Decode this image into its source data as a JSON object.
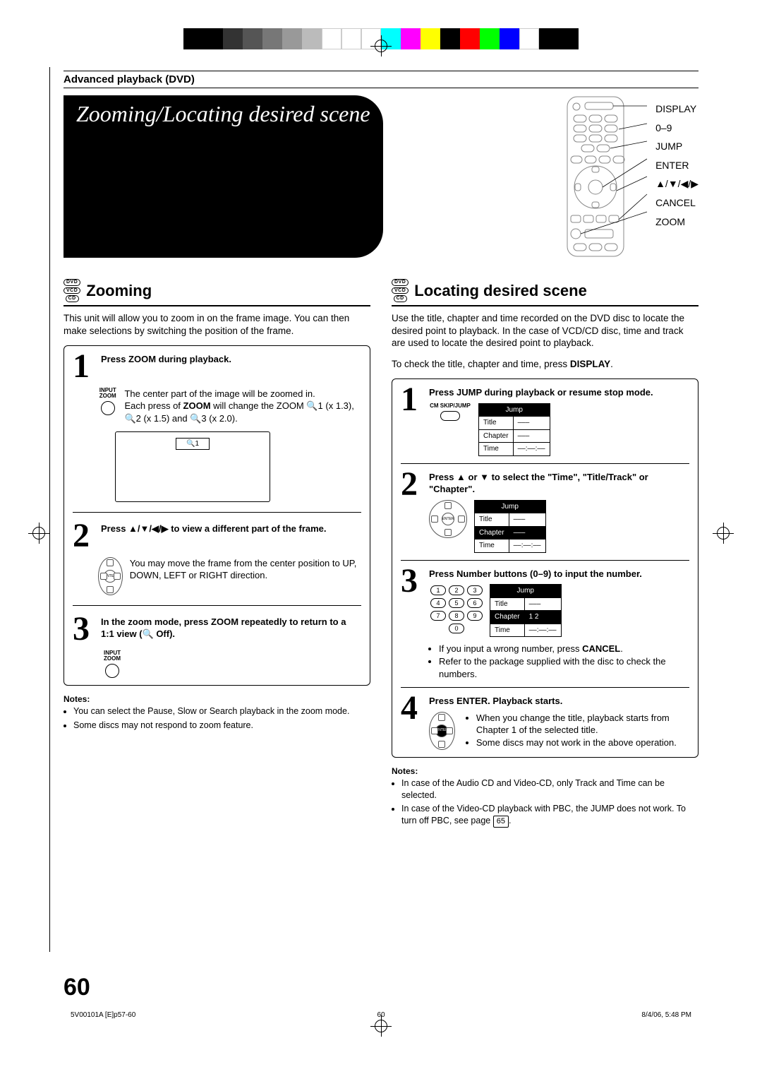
{
  "header": "Advanced playback (DVD)",
  "title": "Zooming/Locating desired scene",
  "remote_labels": [
    "DISPLAY",
    "0–9",
    "JUMP",
    "ENTER",
    "▲/▼/◀/▶",
    "CANCEL",
    "ZOOM"
  ],
  "discs_all": [
    "DVD",
    "VCD",
    "CD"
  ],
  "zoom": {
    "heading": "Zooming",
    "intro": "This unit will allow you to zoom in on the frame image. You can then make selections by switching the position of the frame.",
    "step1": {
      "lead": "Press ZOOM during playback.",
      "icon_label": "INPUT\nZOOM",
      "body_a": "The center part of the image will be zoomed in.",
      "body_b_pre": "Each press of ",
      "body_b_btn": "ZOOM",
      "body_b_post": " will change the ZOOM 🔍1 (x 1.3), 🔍2 (x 1.5) and 🔍3 (x 2.0).",
      "screen_tab": "🔍1"
    },
    "step2": {
      "lead": "Press ▲/▼/◀/▶ to view a different part of the frame.",
      "body": "You may move the frame from the center position to UP, DOWN, LEFT or RIGHT direction."
    },
    "step3": {
      "lead": "In the zoom mode, press ZOOM repeatedly to return to a 1:1 view (🔍 Off).",
      "icon_label": "INPUT\nZOOM"
    },
    "notes_head": "Notes:",
    "notes": [
      "You can select the Pause, Slow or Search playback in the zoom mode.",
      "Some discs may not respond to zoom feature."
    ]
  },
  "locate": {
    "heading": "Locating desired scene",
    "intro": "Use the title, chapter and time recorded on the DVD disc to locate the desired point to playback. In the case of VCD/CD disc, time and track are used to locate the desired point to playback.",
    "check_pre": "To check the title, chapter and time, press ",
    "check_btn": "DISPLAY",
    "check_post": ".",
    "step1": {
      "lead": "Press JUMP during playback or resume stop mode.",
      "icon_label": "CM SKIP/JUMP"
    },
    "step2": {
      "lead": "Press ▲ or ▼ to select the \"Time\", \"Title/Track\" or \"Chapter\"."
    },
    "step3": {
      "lead": "Press Number buttons (0–9) to input the number.",
      "bul1_pre": "If you input a wrong number, press ",
      "bul1_btn": "CANCEL",
      "bul1_post": ".",
      "bul2": "Refer to the package supplied with the disc to check the numbers."
    },
    "step4": {
      "lead": "Press ENTER. Playback starts.",
      "bul1": "When you change the title, playback starts from Chapter 1 of the selected title.",
      "bul2": "Some discs may not work in the above operation."
    },
    "menu": {
      "header": "Jump",
      "rows": [
        "Title",
        "Chapter",
        "Time"
      ],
      "blank3": "–––",
      "blanktime": "––:––:––",
      "chapter_val": "1 2"
    },
    "notes_head": "Notes:",
    "notes1": "In case of the Audio CD and Video-CD, only Track and Time can be selected.",
    "notes2_pre": "In case of the Video-CD playback with PBC, the JUMP does not work. To turn off PBC, see page ",
    "notes2_page": "65",
    "notes2_post": "."
  },
  "pagenum": "60",
  "footer": {
    "left": "5V00101A [E]p57-60",
    "mid": "60",
    "right": "8/4/06, 5:48 PM"
  },
  "regbar_colors": [
    "#000",
    "#000",
    "#333",
    "#555",
    "#777",
    "#999",
    "#bbb",
    "#fff",
    "#0ff",
    "#00f",
    "#f0f",
    "#f00",
    "#ff0",
    "#0f0",
    "#fff",
    "#fff",
    "#000",
    "#000"
  ]
}
